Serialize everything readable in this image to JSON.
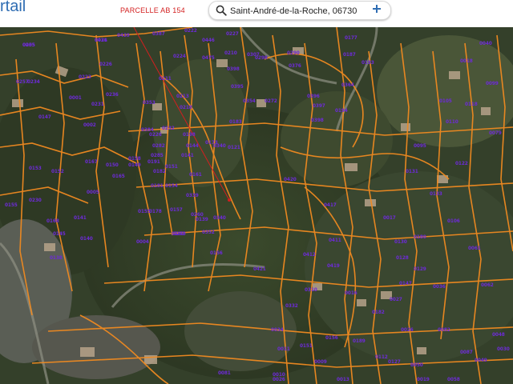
{
  "header": {
    "brand": "rtail",
    "annotation": "PARCELLE AB 154",
    "search": {
      "value": "Saint-André-de-la-Roche, 06730",
      "icon": "search-icon",
      "add_icon": "plus-icon"
    }
  },
  "colors": {
    "parcel_line": "#f08a20",
    "parcel_label": "#6d2bd6",
    "annotation": "#d31f1f",
    "brand": "#2f6db3"
  },
  "parcels": [
    "0255",
    "0436",
    "0439",
    "0387",
    "0222",
    "0446",
    "0227",
    "0226",
    "0257",
    "0224",
    "0223",
    "0231",
    "0210",
    "0307",
    "0177",
    "0475",
    "0298",
    "0187",
    "0398",
    "0395",
    "0376",
    "0396",
    "0193",
    "0397",
    "0354",
    "0364",
    "0194",
    "0272",
    "0290",
    "0234",
    "0236",
    "0211",
    "0001",
    "0147",
    "0002",
    "0353",
    "0218",
    "0232",
    "0213",
    "0384",
    "0198",
    "0173",
    "0183",
    "0226",
    "0285",
    "0282",
    "0121",
    "0191",
    "0141",
    "0158",
    "0150",
    "0153",
    "0152",
    "0149",
    "0230",
    "0168",
    "0167",
    "0165",
    "0151",
    "0154",
    "0005",
    "0182",
    "0181",
    "0178",
    "0260",
    "0339",
    "0161",
    "0340",
    "0340",
    "0155",
    "0141",
    "0145",
    "0140",
    "0139",
    "0160",
    "0155",
    "0157",
    "0352",
    "0258",
    "0004",
    "0144",
    "0138",
    "0156",
    "0421",
    "0398",
    "0420",
    "0417",
    "0411",
    "0419",
    "0412",
    "0310",
    "0332",
    "0034",
    "0011",
    "0010",
    "0009",
    "0151",
    "0156",
    "0189",
    "0182",
    "0112",
    "0127",
    "0130",
    "0180",
    "0131",
    "0133",
    "0017",
    "0147",
    "0106",
    "0129",
    "0128",
    "0016",
    "0095",
    "0122",
    "0110",
    "0105",
    "0079",
    "0099",
    "0118",
    "0018",
    "0040",
    "0027",
    "0026",
    "0061",
    "0062",
    "0036",
    "0082",
    "0087",
    "0048",
    "0058",
    "0050",
    "0049",
    "0030",
    "0081",
    "0026",
    "0013",
    "0019",
    "0005",
    "0021"
  ]
}
